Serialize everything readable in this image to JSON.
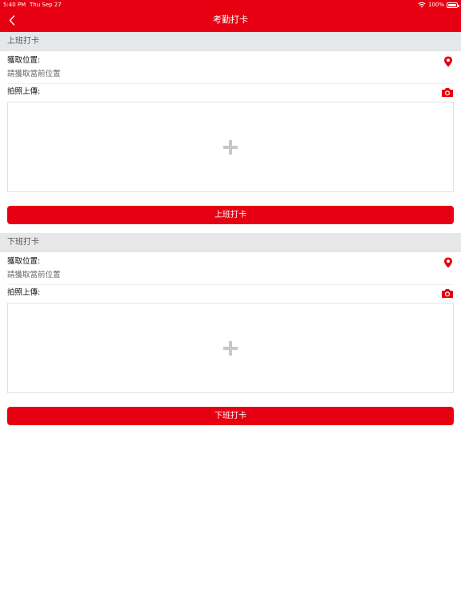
{
  "status_bar": {
    "time": "5:40 PM",
    "date": "Thu Sep 27",
    "battery": "100%"
  },
  "header": {
    "title": "考勤打卡"
  },
  "sections": [
    {
      "header": "上班打卡",
      "location_label": "獲取位置:",
      "location_value": "請獲取當前位置",
      "photo_label": "拍照上傳:",
      "button_label": "上班打卡"
    },
    {
      "header": "下班打卡",
      "location_label": "獲取位置:",
      "location_value": "請獲取當前位置",
      "photo_label": "拍照上傳:",
      "button_label": "下班打卡"
    }
  ],
  "colors": {
    "accent": "#e60012",
    "section_bg": "#e6e7e9"
  },
  "icons": [
    "back-chevron-icon",
    "wifi-icon",
    "battery-icon",
    "location-pin-icon",
    "camera-icon",
    "plus-icon"
  ]
}
